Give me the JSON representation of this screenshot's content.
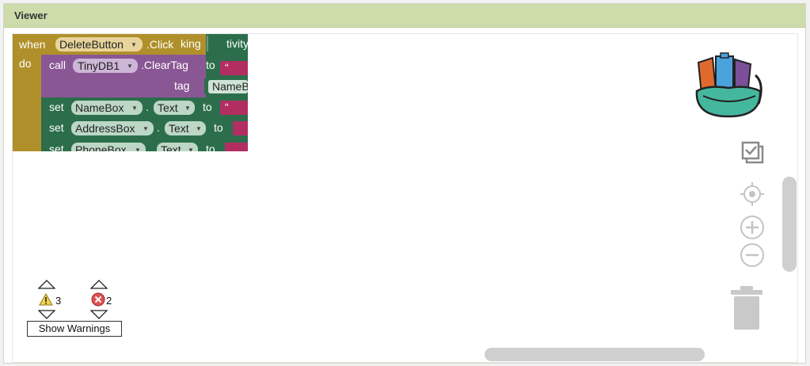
{
  "panel": {
    "title": "Viewer"
  },
  "blocks": {
    "event": {
      "when_label": "when",
      "component": "DeleteButton",
      "event": ".Click",
      "do_label": "do",
      "clipped_1": "king",
      "clipped_2": "tivity"
    },
    "cleartag": {
      "call_label": "call",
      "component": "TinyDB1",
      "method": ".ClearTag",
      "tag_label": "tag",
      "to_label": "to",
      "value": "NameB"
    },
    "set_rows": [
      {
        "set_label": "set",
        "component": "NameBox",
        "dot": ".",
        "property": "Text",
        "to_label": "to"
      },
      {
        "set_label": "set",
        "component": "AddressBox",
        "dot": ".",
        "property": "Text",
        "to_label": "to"
      },
      {
        "set_label": "set",
        "component": "PhoneBox",
        "dot": ".",
        "property": "Text",
        "to_label": "to"
      }
    ],
    "string_quote": "“"
  },
  "warnings": {
    "warning_count": "3",
    "error_count": "2",
    "show_label": "Show Warnings"
  },
  "colors": {
    "event": "#b0902b",
    "procedure": "#8a5795",
    "setter": "#2c6e4b",
    "text": "#b22e62",
    "header": "#cddcaa",
    "scrollbar": "#cfcfcf",
    "backpack_orange": "#df6a2e",
    "backpack_blue": "#4aa3dd",
    "backpack_purple": "#7b4f9a",
    "backpack_teal": "#45b79e"
  }
}
